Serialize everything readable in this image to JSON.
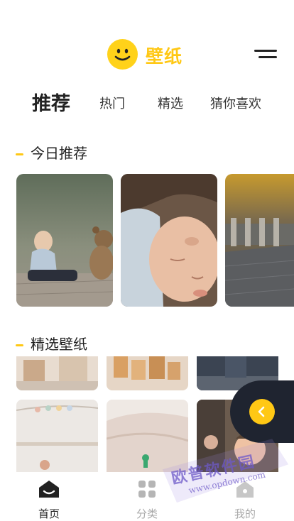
{
  "header": {
    "logo_text": "壁纸"
  },
  "tabs": [
    {
      "label": "推荐",
      "active": true
    },
    {
      "label": "热门",
      "active": false
    },
    {
      "label": "精选",
      "active": false
    },
    {
      "label": "猜你喜欢",
      "active": false
    }
  ],
  "sections": {
    "today": "今日推荐",
    "featured": "精选壁纸"
  },
  "bottom_nav": [
    {
      "label": "首页",
      "icon": "home-icon",
      "active": true
    },
    {
      "label": "分类",
      "icon": "grid-icon",
      "active": false
    },
    {
      "label": "我的",
      "icon": "user-icon",
      "active": false
    }
  ],
  "watermark": {
    "main": "欧普软件园",
    "url": "www.opdown.com"
  },
  "colors": {
    "accent": "#FFC815",
    "dark_panel": "#1f2430"
  }
}
